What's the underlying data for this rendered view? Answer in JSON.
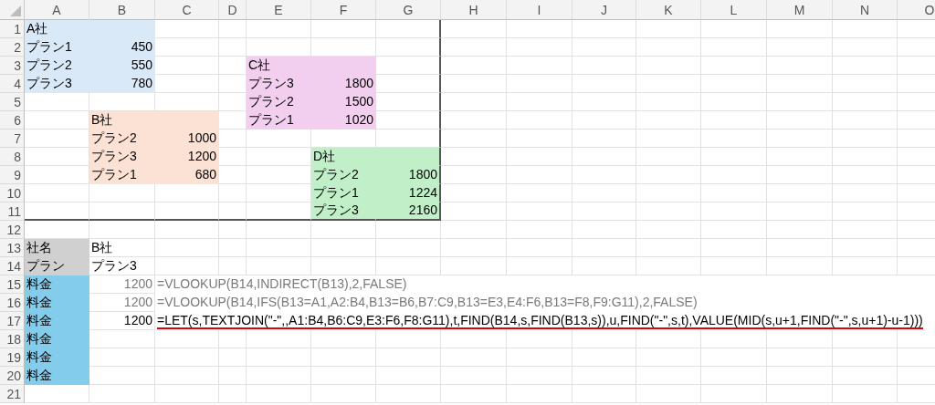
{
  "columns": [
    "A",
    "B",
    "C",
    "D",
    "E",
    "F",
    "G",
    "H",
    "I",
    "J",
    "K",
    "L",
    "M",
    "N",
    "O"
  ],
  "rows": [
    {
      "number": "1",
      "framed": true,
      "cells": [
        {
          "text": "A社",
          "color": "#dae9f7"
        },
        {
          "color": "#dae9f7"
        },
        {},
        {},
        {},
        {},
        {}
      ]
    },
    {
      "number": "2",
      "framed": true,
      "cells": [
        {
          "text": "プラン1",
          "color": "#dae9f7"
        },
        {
          "text": "450",
          "kind": "number",
          "color": "#dae9f7"
        },
        {},
        {},
        {},
        {},
        {}
      ]
    },
    {
      "number": "3",
      "framed": true,
      "cells": [
        {
          "text": "プラン2",
          "color": "#dae9f7"
        },
        {
          "text": "550",
          "kind": "number",
          "color": "#dae9f7"
        },
        {},
        {},
        {
          "text": "C社",
          "color": "#f2cfee"
        },
        {
          "color": "#f2cfee"
        },
        {}
      ]
    },
    {
      "number": "4",
      "framed": true,
      "cells": [
        {
          "text": "プラン3",
          "color": "#dae9f7"
        },
        {
          "text": "780",
          "kind": "number",
          "color": "#dae9f7"
        },
        {},
        {},
        {
          "text": "プラン3",
          "color": "#f2cfee"
        },
        {
          "text": "1800",
          "kind": "number",
          "color": "#f2cfee"
        },
        {}
      ]
    },
    {
      "number": "5",
      "framed": true,
      "cells": [
        {},
        {},
        {},
        {},
        {
          "text": "プラン2",
          "color": "#f2cfee"
        },
        {
          "text": "1500",
          "kind": "number",
          "color": "#f2cfee"
        },
        {}
      ]
    },
    {
      "number": "6",
      "framed": true,
      "cells": [
        {},
        {
          "text": "B社",
          "color": "#fbe2d5"
        },
        {
          "color": "#fbe2d5"
        },
        {},
        {
          "text": "プラン1",
          "color": "#f2cfee"
        },
        {
          "text": "1020",
          "kind": "number",
          "color": "#f2cfee"
        },
        {}
      ]
    },
    {
      "number": "7",
      "framed": true,
      "cells": [
        {},
        {
          "text": "プラン2",
          "color": "#fbe2d5"
        },
        {
          "text": "1000",
          "kind": "number",
          "color": "#fbe2d5"
        },
        {},
        {},
        {},
        {}
      ]
    },
    {
      "number": "8",
      "framed": true,
      "cells": [
        {},
        {
          "text": "プラン3",
          "color": "#fbe2d5"
        },
        {
          "text": "1200",
          "kind": "number",
          "color": "#fbe2d5"
        },
        {},
        {},
        {
          "text": "D社",
          "color": "#c1f0c8"
        },
        {
          "color": "#c1f0c8"
        }
      ]
    },
    {
      "number": "9",
      "framed": true,
      "cells": [
        {},
        {
          "text": "プラン1",
          "color": "#fbe2d5"
        },
        {
          "text": "680",
          "kind": "number",
          "color": "#fbe2d5"
        },
        {},
        {},
        {
          "text": "プラン2",
          "color": "#c1f0c8"
        },
        {
          "text": "1800",
          "kind": "number",
          "color": "#c1f0c8"
        }
      ]
    },
    {
      "number": "10",
      "framed": true,
      "cells": [
        {},
        {},
        {},
        {},
        {},
        {
          "text": "プラン1",
          "color": "#c1f0c8"
        },
        {
          "text": "1224",
          "kind": "number",
          "color": "#c1f0c8"
        }
      ]
    },
    {
      "number": "11",
      "framed": true,
      "cells": [
        {},
        {},
        {},
        {},
        {},
        {
          "text": "プラン3",
          "color": "#c1f0c8"
        },
        {
          "text": "2160",
          "kind": "number",
          "color": "#c1f0c8"
        }
      ]
    },
    {
      "number": "12",
      "cells": []
    },
    {
      "number": "13",
      "cells": [
        {
          "text": "社名",
          "color": "#d0d0d0"
        },
        {
          "text": "B社"
        }
      ]
    },
    {
      "number": "14",
      "cells": [
        {
          "text": "プラン",
          "color": "#d0d0d0"
        },
        {
          "text": "プラン3"
        }
      ]
    },
    {
      "number": "15",
      "cells": [
        {
          "text": "料金",
          "color": "#83cceb"
        },
        {
          "text": "1200",
          "kind": "number",
          "dimmed": true
        },
        {
          "text": "=VLOOKUP(B14,INDIRECT(B13),2,FALSE)",
          "kind": "formula",
          "dimmed": true,
          "underlined": false
        }
      ]
    },
    {
      "number": "16",
      "cells": [
        {
          "text": "料金",
          "color": "#83cceb"
        },
        {
          "text": "1200",
          "kind": "number",
          "dimmed": true
        },
        {
          "text": "=VLOOKUP(B14,IFS(B13=A1,A2:B4,B13=B6,B7:C9,B13=E3,E4:F6,B13=F8,F9:G11),2,FALSE)",
          "kind": "formula",
          "dimmed": true,
          "underlined": false
        }
      ]
    },
    {
      "number": "17",
      "cells": [
        {
          "text": "料金",
          "color": "#83cceb"
        },
        {
          "text": "1200",
          "kind": "number",
          "dimmed": false
        },
        {
          "text": "=LET(s,TEXTJOIN(\"-\",,A1:B4,B6:C9,E3:F6,F8:G11),t,FIND(B14,s,FIND(B13,s)),u,FIND(\"-\",s,t),VALUE(MID(s,u+1,FIND(\"-\",s,u+1)-u-1)))",
          "kind": "formula",
          "dimmed": false,
          "underlined": true
        }
      ]
    },
    {
      "number": "18",
      "cells": [
        {
          "text": "料金",
          "color": "#83cceb"
        }
      ]
    },
    {
      "number": "19",
      "cells": [
        {
          "text": "料金",
          "color": "#83cceb"
        }
      ]
    },
    {
      "number": "20",
      "cells": [
        {
          "text": "料金",
          "color": "#83cceb"
        }
      ]
    },
    {
      "number": "21",
      "cells": []
    }
  ]
}
